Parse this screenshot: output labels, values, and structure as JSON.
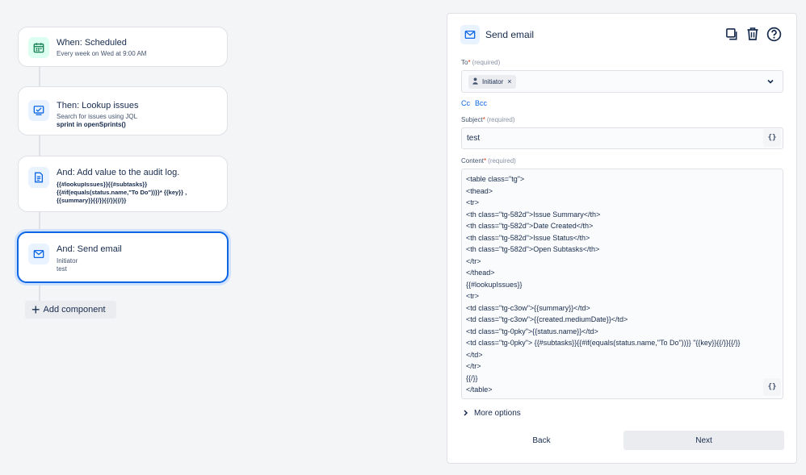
{
  "flow": {
    "trigger": {
      "title": "When: Scheduled",
      "subtitle": "Every week on Wed at 9:00 AM",
      "icon": "calendar-icon"
    },
    "lookup": {
      "title": "Then: Lookup issues",
      "subtitle": "Search for issues using JQL",
      "jql": "sprint in openSprints()",
      "icon": "lookup-icon"
    },
    "audit": {
      "title": "And: Add value to the audit log.",
      "lines": [
        "{{#lookupIssues}}{{#subtasks}}",
        "{{#if(equals(status.name,\"To Do\"))}}* {{key}} ,",
        "{{summary}}{{/}}{{/}}{{/}}"
      ],
      "icon": "document-icon"
    },
    "send_email": {
      "title": "And: Send email",
      "line1": "Initiator",
      "line2": "test",
      "icon": "mail-icon"
    },
    "add_component_label": "Add component"
  },
  "panel": {
    "title": "Send email",
    "icon": "mail-icon",
    "to": {
      "label": "To",
      "required_mark": "*",
      "hint": "(required)",
      "chip": "Initiator"
    },
    "cc_label": "Cc",
    "bcc_label": "Bcc",
    "subject": {
      "label": "Subject",
      "required_mark": "*",
      "hint": "(required)",
      "value": "test"
    },
    "content": {
      "label": "Content",
      "required_mark": "*",
      "hint": "(required)",
      "lines": [
        "<table class=\"tg\">",
        "<thead>",
        "<tr>",
        "<th class=\"tg-582d\">Issue Summary</th>",
        "<th class=\"tg-582d\">Date Created</th>",
        "<th class=\"tg-582d\">Issue Status</th>",
        "<th class=\"tg-582d\">Open Subtasks</th>",
        "</tr>",
        "</thead>",
        "{{#lookupIssues}}",
        "<tr>",
        "<td class=\"tg-c3ow\">{{summary}}</td>",
        "<td class=\"tg-c3ow\">{{created.mediumDate}}</td>",
        "<td class=\"tg-0pky\">{{status.name}}</td>",
        "<td class=\"tg-0pky\"> {{#subtasks}}{{#if(equals(status.name,\"To Do\"))}} \"{{key}}{{/}}{{/}}",
        "</td>",
        "</tr>",
        "{{/}}",
        "</table>"
      ]
    },
    "smart_value_label": "{}",
    "more_options_label": "More options",
    "back_label": "Back",
    "next_label": "Next"
  },
  "colors": {
    "accent": "#0c66e4",
    "background": "#f4f5f7",
    "trigger_icon_bg": "#dcfff1",
    "action_icon_bg": "#e9f2ff"
  }
}
